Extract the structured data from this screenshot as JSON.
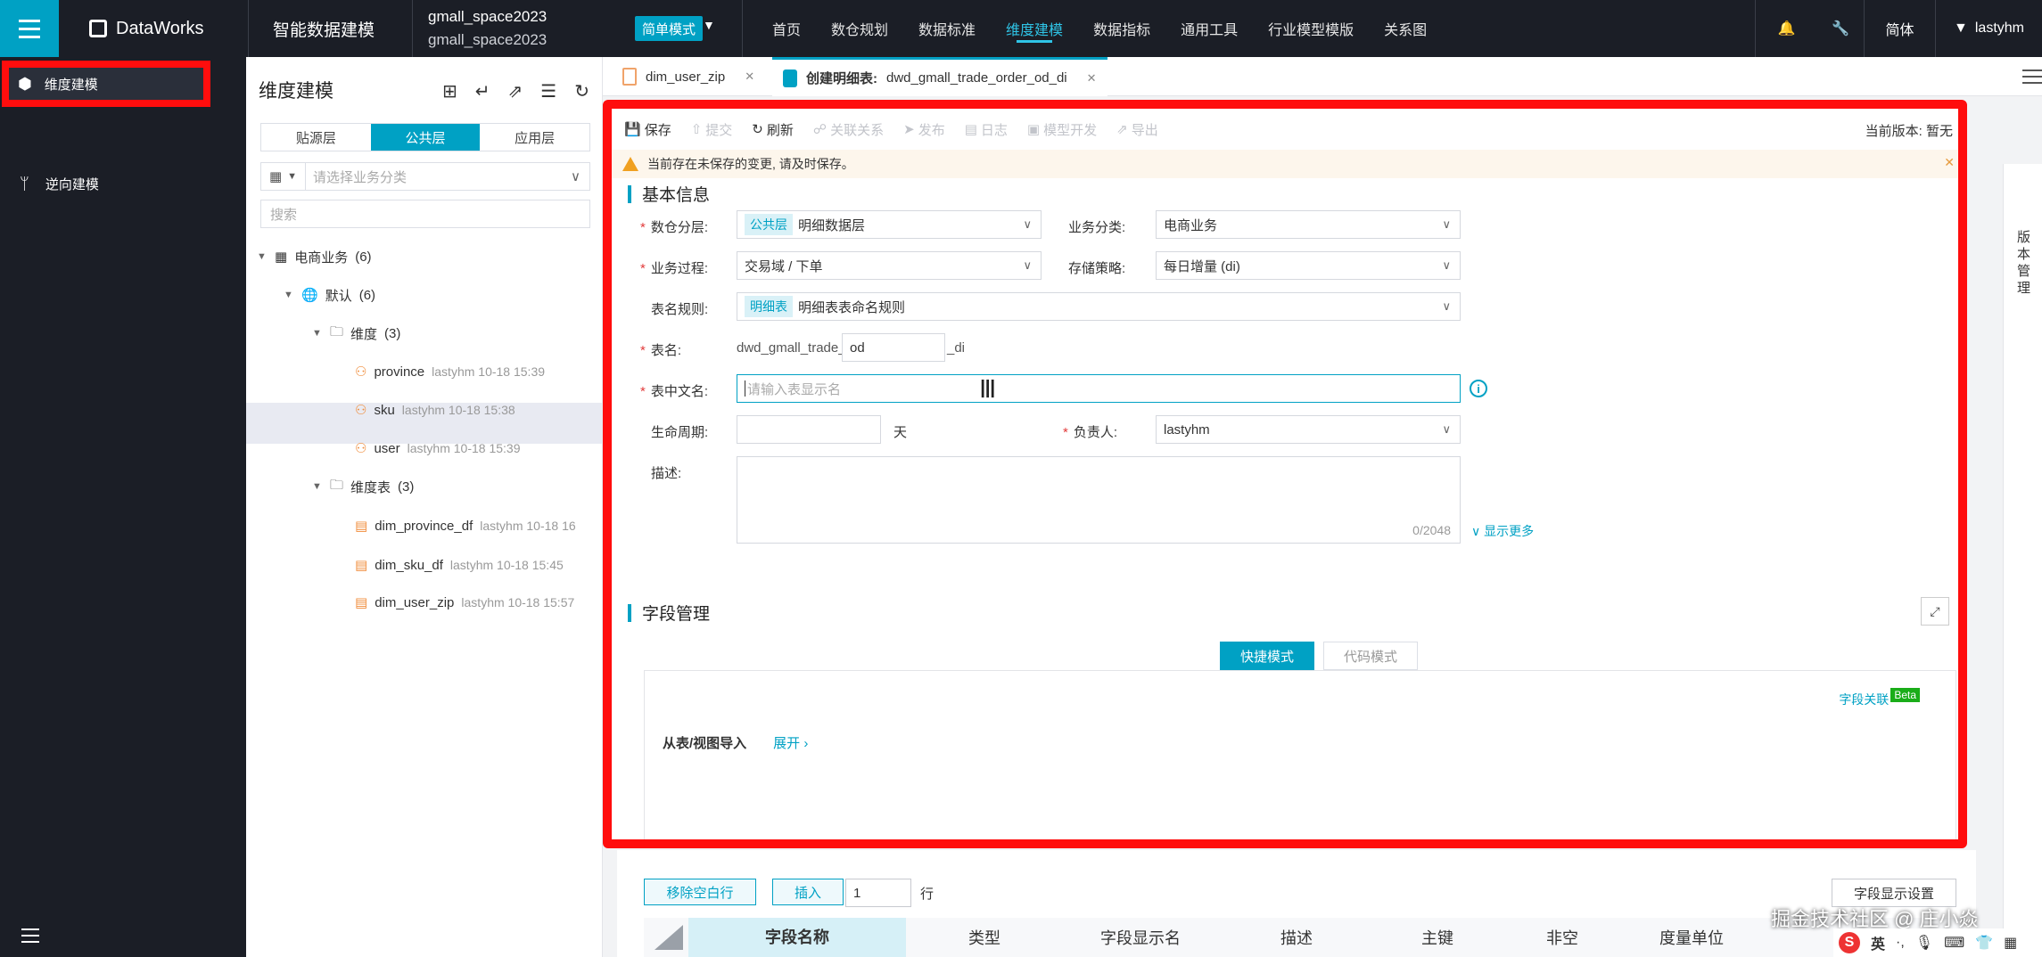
{
  "topbar": {
    "logo": "DataWorks",
    "product": "智能数据建模",
    "workspace_name": "gmall_space2023",
    "workspace_sub": "gmall_space2023",
    "mode": "简单模式",
    "nav": [
      "首页",
      "数仓规划",
      "数据标准",
      "维度建模",
      "数据指标",
      "通用工具",
      "行业模型模版",
      "关系图"
    ],
    "active_nav": "维度建模",
    "lang": "简体",
    "user": "lastyhm"
  },
  "rail": {
    "items": [
      {
        "label": "维度建模",
        "icon": "cube-icon"
      },
      {
        "label": "逆向建模",
        "icon": "reverse-model-icon"
      }
    ]
  },
  "tree": {
    "title": "维度建模",
    "layer_tabs": [
      "贴源层",
      "公共层",
      "应用层"
    ],
    "active_layer": "公共层",
    "category_placeholder": "请选择业务分类",
    "search_placeholder": "搜索",
    "nodes": [
      {
        "label": "电商业务",
        "count": "(6)",
        "level": 0
      },
      {
        "label": "默认",
        "count": "(6)",
        "level": 1
      },
      {
        "label": "维度",
        "count": "(3)",
        "level": 2
      },
      {
        "label": "province",
        "meta": "lastyhm 10-18 15:39",
        "level": 3
      },
      {
        "label": "sku",
        "meta": "lastyhm 10-18 15:38",
        "level": 3
      },
      {
        "label": "user",
        "meta": "lastyhm 10-18 15:39",
        "level": 3
      },
      {
        "label": "维度表",
        "count": "(3)",
        "level": 2
      },
      {
        "label": "dim_province_df",
        "meta": "lastyhm 10-18 16",
        "level": 3
      },
      {
        "label": "dim_sku_df",
        "meta": "lastyhm 10-18 15:45",
        "level": 3
      },
      {
        "label": "dim_user_zip",
        "meta": "lastyhm 10-18 15:57",
        "level": 3
      }
    ]
  },
  "tabs": [
    {
      "label": "dim_user_zip"
    },
    {
      "prefix": "创建明细表:",
      "label": "dwd_gmall_trade_order_od_di"
    }
  ],
  "toolbar": {
    "save": "保存",
    "submit": "提交",
    "refresh": "刷新",
    "relation": "关联关系",
    "publish": "发布",
    "log": "日志",
    "model_dev": "模型开发",
    "export": "导出",
    "version": "当前版本:  暂无"
  },
  "warning": "当前存在未保存的变更, 请及时保存。",
  "version_panel": "版本管理",
  "basic": {
    "title": "基本信息",
    "layer_label": "数仓分层:",
    "layer_tag": "公共层",
    "layer_value": "明细数据层",
    "biz_label": "业务分类:",
    "biz_value": "电商业务",
    "process_label": "业务过程:",
    "process_value": "交易域 / 下单",
    "storage_label": "存储策略:",
    "storage_value": "每日增量 (di)",
    "rule_label": "表名规则:",
    "rule_tag": "明细表",
    "rule_value": "明细表表命名规则",
    "name_label": "表名:",
    "name_prefix": "dwd_gmall_trade_order_",
    "name_input": "od",
    "name_suffix": "_di",
    "cn_label": "表中文名:",
    "cn_placeholder": "请输入表显示名",
    "life_label": "生命周期:",
    "life_unit": "天",
    "owner_label": "负责人:",
    "owner_value": "lastyhm",
    "desc_label": "描述:",
    "desc_count": "0/2048",
    "more": "显示更多"
  },
  "fields": {
    "title": "字段管理",
    "modes": [
      "快捷模式",
      "代码模式"
    ],
    "relation": "字段关联",
    "beta": "Beta",
    "import_label": "从表/视图导入",
    "expand": "展开"
  },
  "below": {
    "remove_empty": "移除空白行",
    "insert": "插入",
    "insert_count": "1",
    "row_unit": "行",
    "display_settings": "字段显示设置",
    "columns": [
      "字段名称",
      "类型",
      "字段显示名",
      "描述",
      "主键",
      "非空",
      "度量单位"
    ]
  },
  "watermark": "掘金技术社区 @ 庄小焱",
  "ime": {
    "lang": "英"
  }
}
